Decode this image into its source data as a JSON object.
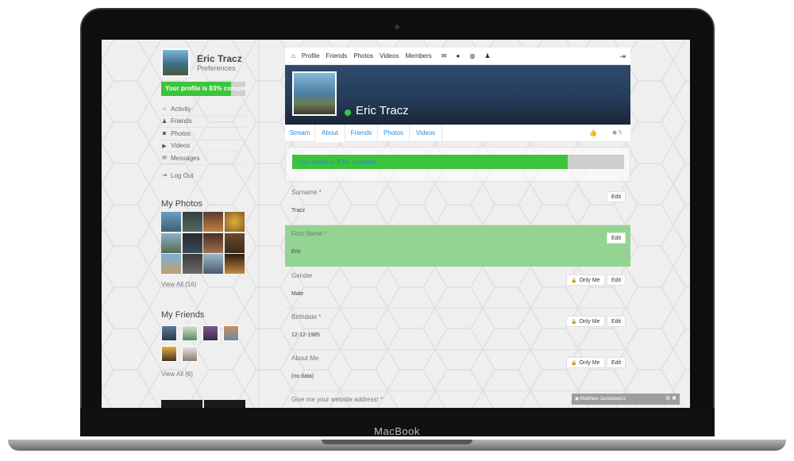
{
  "device": {
    "brand": "MacBook"
  },
  "sidebar": {
    "user_name": "Eric Tracz",
    "user_subtitle": "Preferences",
    "progress_text": "Your profile is 83% complete",
    "progress_fraction": 0.83,
    "nav": [
      {
        "label": "Activity",
        "icon": "home-icon"
      },
      {
        "label": "Friends",
        "icon": "users-icon"
      },
      {
        "label": "Photos",
        "icon": "camera-icon"
      },
      {
        "label": "Videos",
        "icon": "video-icon"
      },
      {
        "label": "Messages",
        "icon": "envelope-icon"
      }
    ],
    "logout_label": "Log Out",
    "photos_title": "My Photos",
    "photos_view_all": "View All (16)",
    "friends_title": "My Friends",
    "friends_view_all": "View All (6)"
  },
  "topbar": {
    "items": [
      "Profile",
      "Friends",
      "Photos",
      "Videos",
      "Members"
    ]
  },
  "profile": {
    "name": "Eric Tracz",
    "tabs": [
      "Stream",
      "About",
      "Friends",
      "Photos",
      "Videos"
    ],
    "view_count": "5",
    "progress_text": "Your profile is 83% complete",
    "progress_fraction": 0.83
  },
  "fields": [
    {
      "label": "Surname *",
      "value": "Tracz",
      "edit": "Edit"
    },
    {
      "label": "First Name *",
      "value": "Eric",
      "edit": "Edit"
    },
    {
      "label": "Gender",
      "value": "Male",
      "visibility": "Only Me",
      "edit": "Edit"
    },
    {
      "label": "Birthdate *",
      "value": "12-12-1985",
      "visibility": "Only Me",
      "edit": "Edit"
    },
    {
      "label": "About Me",
      "value": "(no data)",
      "visibility": "Only Me",
      "edit": "Edit"
    },
    {
      "label": "Give me your website address! *",
      "value": ""
    }
  ],
  "chat": {
    "user": "Matthew Jasiukiewicz"
  },
  "colors": {
    "accent": "#2b8ad6",
    "progress": "#3cc43c",
    "highlight": "#93d493",
    "cover": "#243b58"
  }
}
